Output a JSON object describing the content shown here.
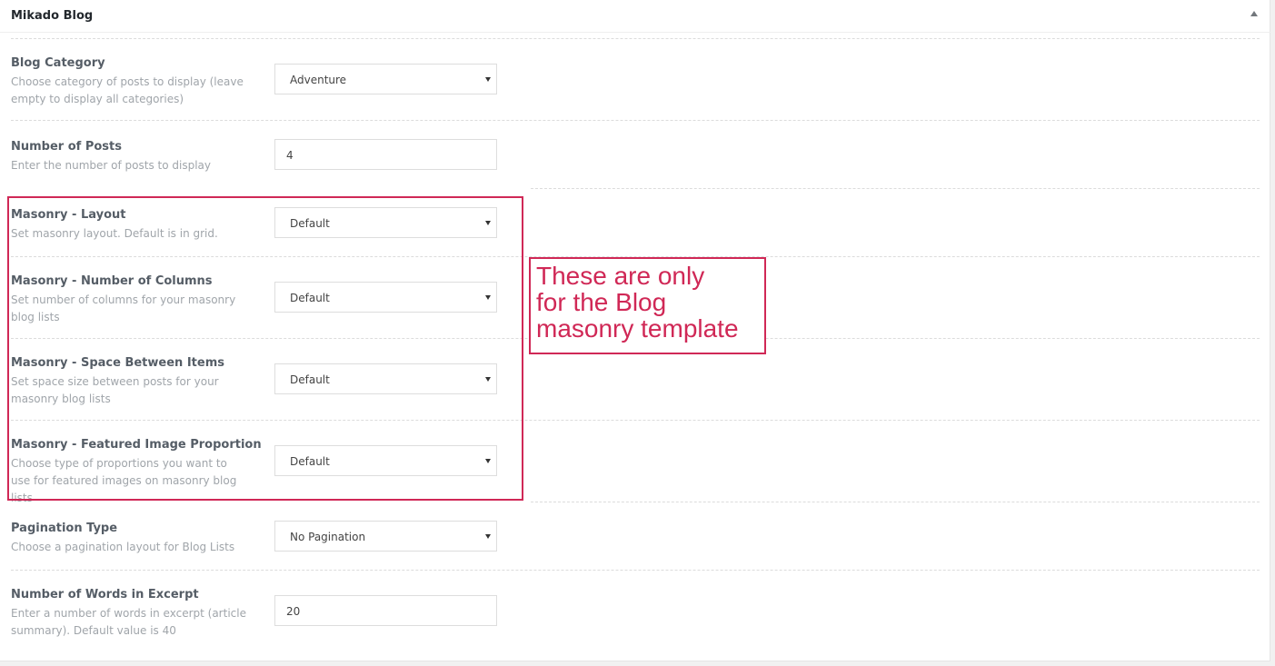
{
  "panel": {
    "title": "Mikado Blog"
  },
  "fields": [
    {
      "label": "Blog Category",
      "description": "Choose category of posts to display (leave empty to display all categories)",
      "type": "select",
      "value": "Adventure"
    },
    {
      "label": "Number of Posts",
      "description": "Enter the number of posts to display",
      "type": "input",
      "value": "4"
    },
    {
      "label": "Masonry - Layout",
      "description": "Set masonry layout. Default is in grid.",
      "type": "select",
      "value": "Default"
    },
    {
      "label": "Masonry - Number of Columns",
      "description": "Set number of columns for your masonry blog lists",
      "type": "select",
      "value": "Default"
    },
    {
      "label": "Masonry - Space Between Items",
      "description": "Set space size between posts for your masonry blog lists",
      "type": "select",
      "value": "Default"
    },
    {
      "label": "Masonry - Featured Image Proportion",
      "description": "Choose type of proportions you want to use for featured images on masonry blog lists",
      "type": "select",
      "value": "Default"
    },
    {
      "label": "Pagination Type",
      "description": "Choose a pagination layout for Blog Lists",
      "type": "select",
      "value": "No Pagination"
    },
    {
      "label": "Number of Words in Excerpt",
      "description": "Enter a number of words in excerpt (article summary). Default value is 40",
      "type": "input",
      "value": "20"
    }
  ],
  "annotation": {
    "text": "These are only\nfor the Blog\nmasonry template",
    "color": "#d02856"
  }
}
